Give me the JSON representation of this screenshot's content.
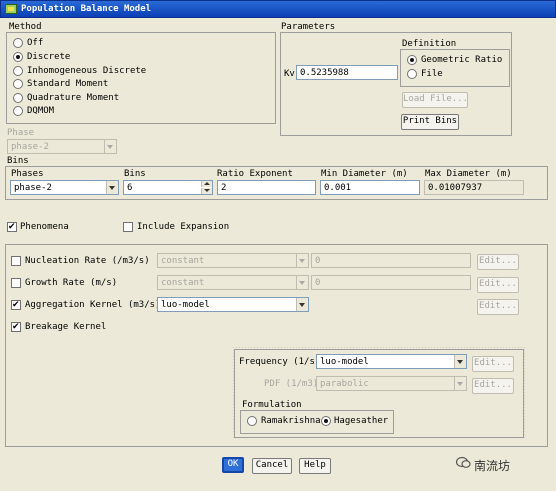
{
  "window": {
    "title": "Population Balance Model"
  },
  "method": {
    "label": "Method",
    "options": [
      "Off",
      "Discrete",
      "Inhomogeneous Discrete",
      "Standard Moment",
      "Quadrature Moment",
      "DQMOM"
    ],
    "selected": "Discrete"
  },
  "parameters": {
    "label": "Parameters",
    "kv_label": "Kv",
    "kv_value": "0.5235988",
    "definition": {
      "label": "Definition",
      "options": [
        "Geometric Ratio",
        "File"
      ],
      "selected": "Geometric Ratio"
    },
    "load_file_label": "Load File...",
    "print_bins_label": "Print Bins"
  },
  "phase": {
    "label": "Phase",
    "value": "phase-2"
  },
  "bins": {
    "label": "Bins",
    "headers": [
      "Phases",
      "Bins",
      "Ratio Exponent",
      "Min Diameter (m)",
      "Max Diameter (m)"
    ],
    "phases_value": "phase-2",
    "bins_value": "6",
    "ratio_exponent": "2",
    "min_diameter": "0.001",
    "max_diameter": "0.01007937"
  },
  "phenomena": {
    "label": "Phenomena",
    "checked": true,
    "include_expansion_label": "Include Expansion",
    "include_expansion_checked": false
  },
  "kernels": {
    "nucleation": {
      "label": "Nucleation Rate (/m3/s)",
      "checked": false,
      "method": "constant",
      "value": "0",
      "edit_label": "Edit..."
    },
    "growth": {
      "label": "Growth Rate (m/s)",
      "checked": false,
      "method": "constant",
      "value": "0",
      "edit_label": "Edit..."
    },
    "aggregation": {
      "label": "Aggregation Kernel (m3/s)",
      "checked": true,
      "method": "luo-model",
      "edit_label": "Edit..."
    },
    "breakage": {
      "label": "Breakage Kernel",
      "checked": true
    }
  },
  "breakage_panel": {
    "frequency_label": "Frequency (1/s)",
    "frequency_value": "luo-model",
    "pdf_label": "PDF (1/m3)",
    "pdf_value": "parabolic",
    "edit_label": "Edit...",
    "formulation_label": "Formulation",
    "formulation_options": [
      "Ramakrishna",
      "Hagesather"
    ],
    "formulation_selected": "Hagesather"
  },
  "footer": {
    "ok_label": "OK",
    "cancel_label": "Cancel",
    "help_label": "Help"
  },
  "watermark": {
    "text": "南流坊"
  }
}
